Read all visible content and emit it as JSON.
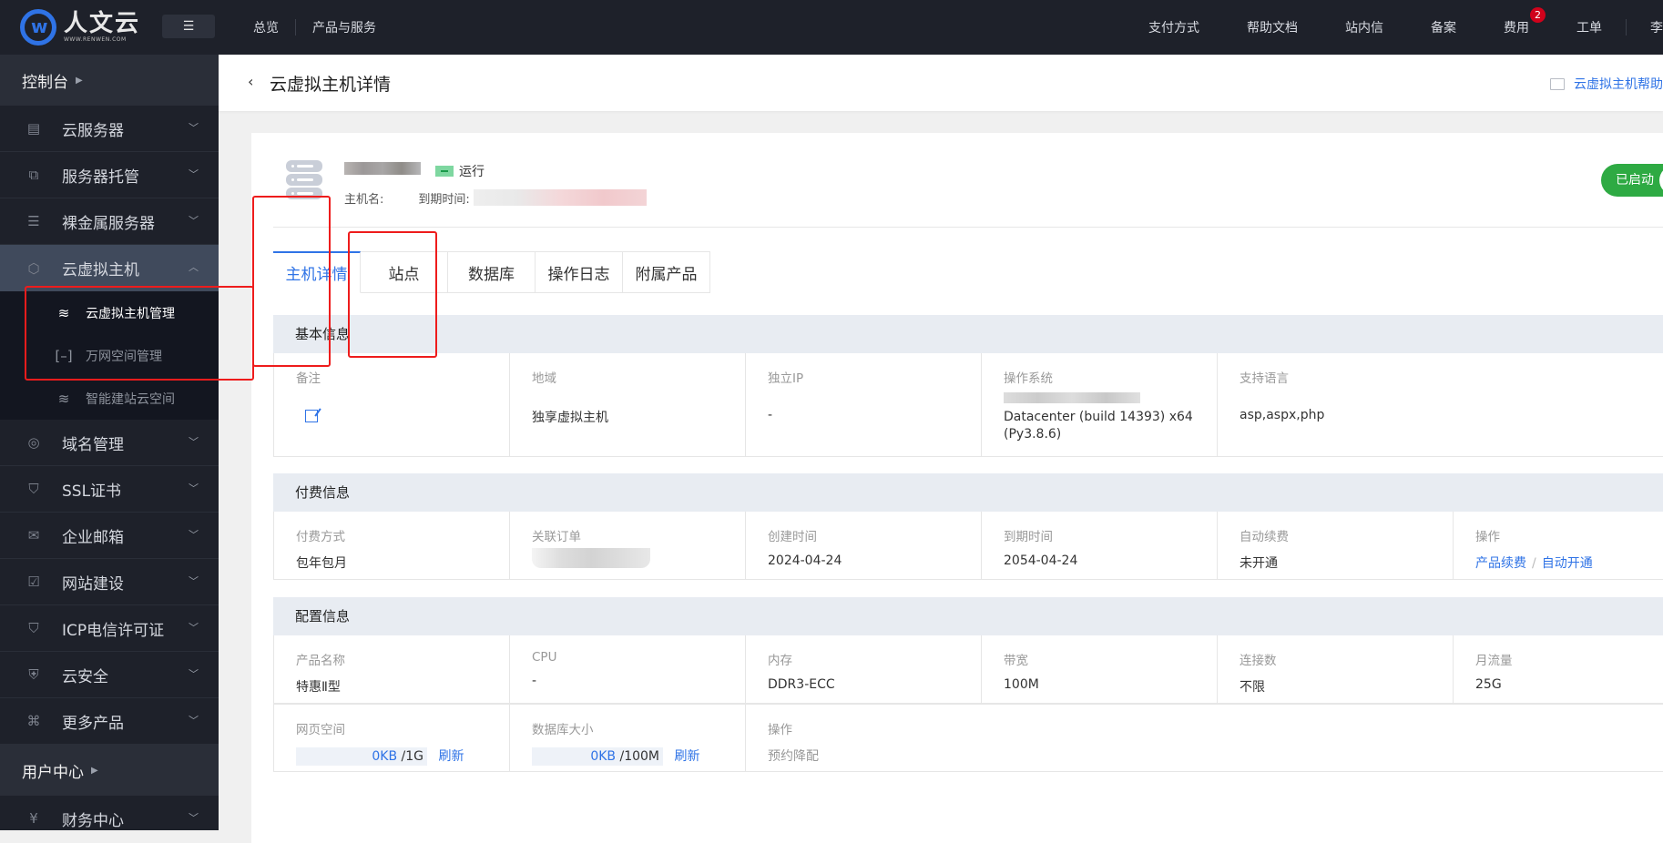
{
  "topbar": {
    "logo_cn": "人文云",
    "logo_en": "WWW.RENWEN.COM",
    "menu_toggle_icon": "☰",
    "nav_left": [
      "总览",
      "产品与服务"
    ],
    "nav_right": {
      "payment": "支付方式",
      "docs": "帮助文档",
      "messages": "站内信",
      "filing": "备案",
      "fees": "费用",
      "fees_badge": "2",
      "tickets": "工单",
      "user": "李倩"
    }
  },
  "sidebar": {
    "console": "控制台",
    "items": [
      {
        "label": "云服务器",
        "icon": "cloud-server-icon",
        "glyph": "▤"
      },
      {
        "label": "服务器托管",
        "icon": "hosting-icon",
        "glyph": "⧉"
      },
      {
        "label": "裸金属服务器",
        "icon": "bare-metal-icon",
        "glyph": "☰"
      },
      {
        "label": "云虚拟主机",
        "icon": "cube-icon",
        "glyph": "⬡"
      }
    ],
    "subitems": [
      {
        "label": "云虚拟主机管理",
        "icon": "layers-icon",
        "glyph": "≋"
      },
      {
        "label": "万网空间管理",
        "icon": "bracket-icon",
        "glyph": "[–]"
      },
      {
        "label": "智能建站云空间",
        "icon": "layers-icon",
        "glyph": "≋"
      }
    ],
    "items2": [
      {
        "label": "域名管理",
        "icon": "www-icon",
        "glyph": "◎"
      },
      {
        "label": "SSL证书",
        "icon": "ssl-shield-icon",
        "glyph": "⛉"
      },
      {
        "label": "企业邮箱",
        "icon": "mail-icon",
        "glyph": "✉"
      },
      {
        "label": "网站建设",
        "icon": "monitor-check-icon",
        "glyph": "☑"
      },
      {
        "label": "ICP电信许可证",
        "icon": "badge-shield-icon",
        "glyph": "⛉"
      },
      {
        "label": "云安全",
        "icon": "shield-plus-icon",
        "glyph": "⛨"
      },
      {
        "label": "更多产品",
        "icon": "command-icon",
        "glyph": "⌘"
      }
    ],
    "user_center": "用户中心",
    "finance": {
      "label": "财务中心",
      "glyph": "¥"
    }
  },
  "page": {
    "title": "云虚拟主机详情",
    "help_link": "云虚拟主机帮助"
  },
  "host": {
    "status": "运行",
    "host_name_label": "主机名:",
    "expire_label": "到期时间:",
    "power_toggle": "已启动"
  },
  "tabs": [
    "主机详情",
    "站点",
    "数据库",
    "操作日志",
    "附属产品"
  ],
  "basic": {
    "title": "基本信息",
    "fields": [
      {
        "label": "备注",
        "value": ""
      },
      {
        "label": "地域",
        "value": "独享虚拟主机"
      },
      {
        "label": "独立IP",
        "value": "-"
      },
      {
        "label": "操作系统",
        "value_line2": "Datacenter (build 14393) x64",
        "value_line3": "(Py3.8.6)"
      },
      {
        "label": "支持语言",
        "value": "asp,aspx,php"
      }
    ]
  },
  "billing": {
    "title": "付费信息",
    "fields": [
      {
        "label": "付费方式",
        "value": "包年包月"
      },
      {
        "label": "关联订单",
        "value": ""
      },
      {
        "label": "创建时间",
        "value": "2024-04-24"
      },
      {
        "label": "到期时间",
        "value": "2054-04-24"
      },
      {
        "label": "自动续费",
        "value": "未开通"
      },
      {
        "label": "操作",
        "action1": "产品续费",
        "action2": "自动开通"
      }
    ]
  },
  "config": {
    "title": "配置信息",
    "fields": [
      {
        "label": "产品名称",
        "value": "特惠Ⅱ型"
      },
      {
        "label": "CPU",
        "value": "-"
      },
      {
        "label": "内存",
        "value": "DDR3-ECC"
      },
      {
        "label": "带宽",
        "value": "100M"
      },
      {
        "label": "连接数",
        "value": "不限"
      },
      {
        "label": "月流量",
        "value": "25G"
      }
    ],
    "row2": [
      {
        "label": "网页空间",
        "used": "0KB",
        "total": " /1G",
        "action": "刷新",
        "used_fraction": 0
      },
      {
        "label": "数据库大小",
        "used": "0KB",
        "total": " /100M",
        "action": "刷新",
        "used_fraction": 0
      },
      {
        "label": "操作",
        "value": "预约降配"
      }
    ]
  }
}
